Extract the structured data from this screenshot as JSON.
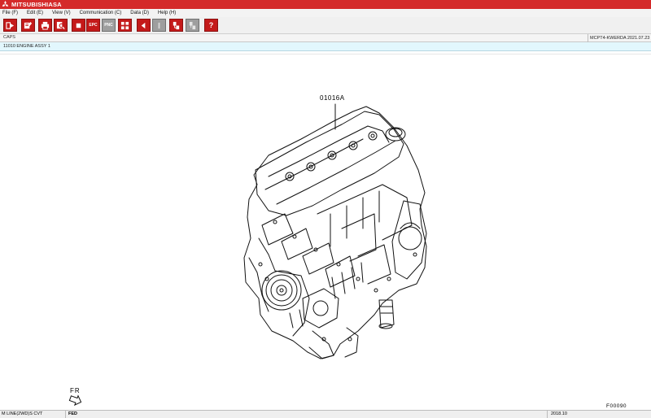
{
  "window": {
    "title": "MITSUBISHIASA",
    "brand_color": "#d42a2a"
  },
  "menu": [
    {
      "label": "File (F)"
    },
    {
      "label": "Edit (E)"
    },
    {
      "label": "View (V)"
    },
    {
      "label": "Communication (C)"
    },
    {
      "label": "Data (D)"
    },
    {
      "label": "Help (H)"
    }
  ],
  "toolbar": {
    "buttons": [
      {
        "icon": "exit-icon"
      },
      {
        "icon": "edit-list-icon"
      },
      {
        "icon": "print-icon"
      },
      {
        "icon": "search-icon"
      },
      {
        "icon": "stop-icon"
      },
      {
        "icon": "epc-icon",
        "label": "EPC"
      },
      {
        "icon": "pnc-icon",
        "label": "PNC"
      },
      {
        "icon": "grid-icon"
      },
      {
        "icon": "back-arrow-icon"
      },
      {
        "icon": "blank-icon"
      },
      {
        "icon": "bookmark-icon"
      },
      {
        "icon": "settings-icon"
      },
      {
        "icon": "help-icon",
        "label": "?"
      }
    ]
  },
  "breadcrumb": {
    "text": "CAPS"
  },
  "model_info": {
    "text": "MCPT4-KWERDA 2021.07.23"
  },
  "group": {
    "title": "11010 ENGINE ASSY 1"
  },
  "illustration": {
    "part_callout": "01016A",
    "orientation_label": "FR",
    "figure_number": "F00090"
  },
  "status": {
    "left": "M LINE(2WD)S CVT",
    "right": "FED",
    "date": "2018.10"
  }
}
